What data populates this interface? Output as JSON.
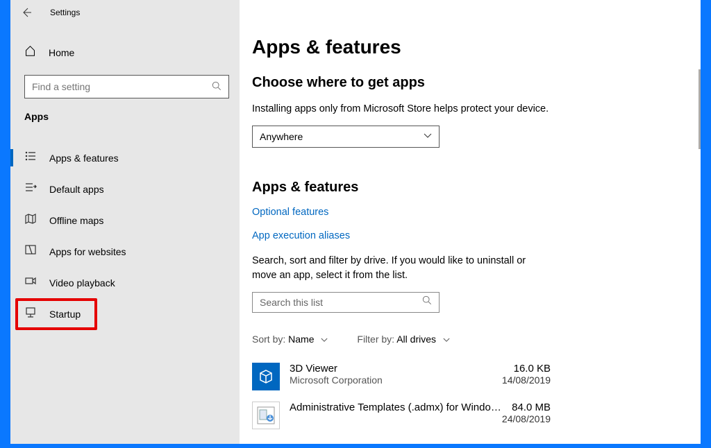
{
  "window": {
    "title": "Settings"
  },
  "sidebar": {
    "home": "Home",
    "search_placeholder": "Find a setting",
    "section": "Apps",
    "items": [
      {
        "label": "Apps & features"
      },
      {
        "label": "Default apps"
      },
      {
        "label": "Offline maps"
      },
      {
        "label": "Apps for websites"
      },
      {
        "label": "Video playback"
      },
      {
        "label": "Startup"
      }
    ]
  },
  "content": {
    "heading": "Apps & features",
    "choose_title": "Choose where to get apps",
    "choose_desc": "Installing apps only from Microsoft Store helps protect your device.",
    "choose_value": "Anywhere",
    "af_title": "Apps & features",
    "link_optional": "Optional features",
    "link_aliases": "App execution aliases",
    "af_desc1": "Search, sort and filter by drive. If you would like to uninstall or",
    "af_desc2": "move an app, select it from the list.",
    "search_placeholder": "Search this list",
    "sort_label": "Sort by:",
    "sort_value": "Name",
    "filter_label": "Filter by:",
    "filter_value": "All drives",
    "apps": [
      {
        "name": "3D Viewer",
        "publisher": "Microsoft Corporation",
        "size": "16.0 KB",
        "date": "14/08/2019"
      },
      {
        "name": "Administrative Templates (.admx) for Windo…",
        "publisher": "",
        "size": "84.0 MB",
        "date": "24/08/2019"
      }
    ]
  }
}
